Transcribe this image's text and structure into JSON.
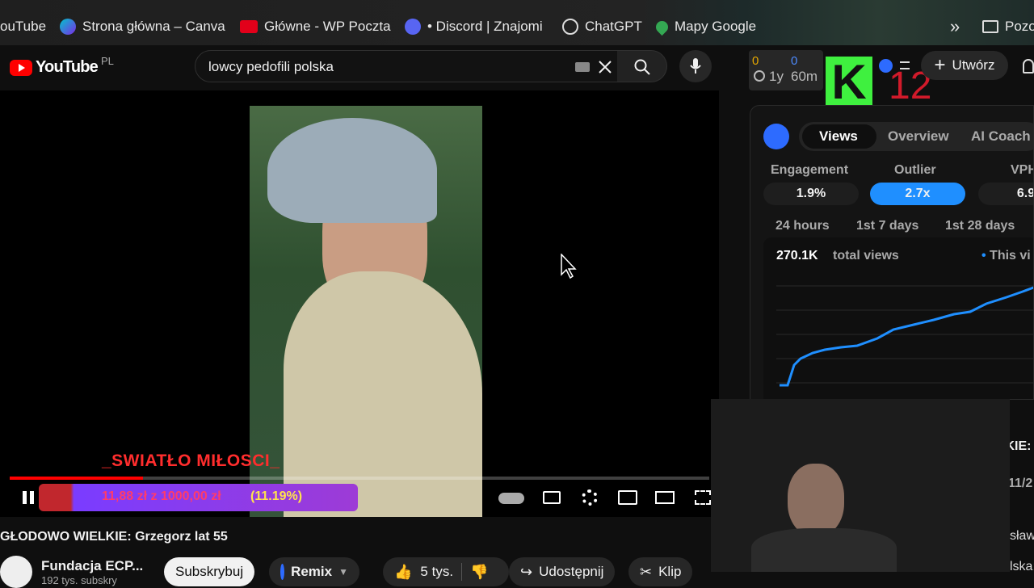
{
  "bookmarks": [
    {
      "label": "ouTube",
      "icon": "youtube-icon",
      "color": "#ff0000"
    },
    {
      "label": "Strona główna – Canva",
      "icon": "canva-icon",
      "color": "#7d2ae8"
    },
    {
      "label": "Główne - WP Poczta",
      "icon": "wp-icon",
      "color": "#e2001a"
    },
    {
      "label": "• Discord | Znajomi",
      "icon": "discord-icon",
      "color": "#5865f2"
    },
    {
      "label": "ChatGPT",
      "icon": "chatgpt-icon",
      "color": "#ffffff"
    },
    {
      "label": "Mapy Google",
      "icon": "maps-pin-icon",
      "color": "#34a853"
    },
    {
      "label": "Pozo",
      "icon": "folder-icon",
      "color": "#ffffff"
    }
  ],
  "masthead": {
    "logo_text": "YouTube",
    "country_code": "PL",
    "search_value": "lowcy pedofili polska",
    "create_label": "Utwórz",
    "timer": {
      "top_left": "0",
      "top_right": "0",
      "bottom_left": "1y",
      "bottom_right": "60m"
    },
    "ext_letter": "K",
    "ext_number": "12"
  },
  "video": {
    "overlay_caption": "_SWIATŁO MIŁOSCI_",
    "donation_text": "11,88 zł z 1000,00 zł",
    "donation_percent": "(11.19%)",
    "progress_fraction": 0.19
  },
  "vidiq": {
    "tabs": [
      "Views",
      "Overview",
      "AI Coach"
    ],
    "active_tab": "Views",
    "metrics": [
      {
        "label": "Engagement",
        "value": "1.9%"
      },
      {
        "label": "Outlier",
        "value": "2.7x"
      },
      {
        "label": "VPH",
        "value": "6.9"
      }
    ],
    "periods": [
      "24 hours",
      "1st 7 days",
      "1st 28 days"
    ],
    "total_views_number": "270.1K",
    "total_views_label": "total views",
    "legend": "This vi",
    "accent": "#1f8fff"
  },
  "below": {
    "title": "GŁODOWO WIELKIE: Grzegorz lat 55",
    "channel_name": "Fundacja ECP...",
    "subscribers": "192 tys. subskry",
    "subscribe_label": "Subskrybuj",
    "remix_label": "Remix",
    "likes": "5 tys.",
    "share_label": "Udostępnij",
    "clip_label": "Klip",
    "side_text_1": "IKIE: ",
    "side_text_2": "11/2",
    "side_text_3": "sław",
    "side_text_4": "lska:"
  }
}
